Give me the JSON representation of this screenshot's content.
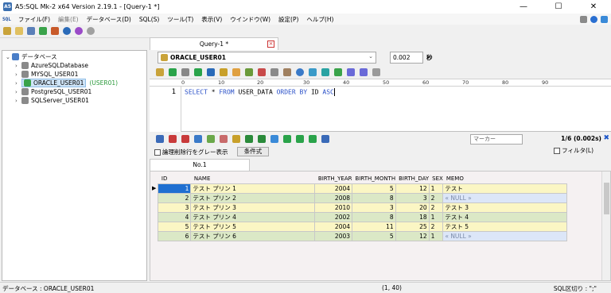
{
  "window": {
    "app_icon": "A5",
    "title": "A5:SQL Mk-2 x64 Version 2.19.1 - [Query-1 *]",
    "controls": [
      "—",
      "☐",
      "✕"
    ]
  },
  "menu": {
    "sql_tag": "SQL",
    "items": [
      "ファイル(F)",
      "編集(E)",
      "データベース(D)",
      "SQL(S)",
      "ツール(T)",
      "表示(V)",
      "ウインドウ(W)",
      "設定(P)",
      "ヘルプ(H)"
    ]
  },
  "tree": {
    "root": "データベース",
    "items": [
      {
        "label": "AzureSQLDatabase",
        "connected": ""
      },
      {
        "label": "MYSQL_USER01",
        "connected": ""
      },
      {
        "label": "ORACLE_USER01",
        "connected": "(USER01)"
      },
      {
        "label": "PostgreSQL_USER01",
        "connected": ""
      },
      {
        "label": "SQLServer_USER01",
        "connected": ""
      }
    ]
  },
  "query_tab": {
    "label": "Query-1 *"
  },
  "connection": {
    "selected": "ORACLE_USER01",
    "time": "0.002",
    "time_unit": "秒"
  },
  "ruler": {
    "marks": [
      "0",
      "10",
      "20",
      "30",
      "40",
      "50",
      "60",
      "70",
      "80",
      "90"
    ]
  },
  "editor": {
    "line_number": "1",
    "sql": {
      "k1": "SELECT",
      "sp1": " * ",
      "k2": "FROM",
      "tbl": " USER_DATA ",
      "k3": "ORDER BY",
      "col": " ID ",
      "k4": "ASC"
    }
  },
  "result": {
    "marker_placeholder": "マーカー",
    "row_count": "1/6 (0.002s)",
    "close_glyph": "✖",
    "gray_deleted_label": "論理削除行をグレー表示",
    "condition_button": "条件式",
    "filter_label": "フィルタ(L)",
    "tab_label": "No.1"
  },
  "grid": {
    "columns": [
      "ID",
      "NAME",
      "BIRTH_YEAR",
      "BIRTH_MONTH",
      "BIRTH_DAY",
      "SEX",
      "MEMO"
    ],
    "rows": [
      {
        "id": "1",
        "name": "テスト プリン 1",
        "year": "2004",
        "month": "5",
        "day": "12",
        "sex": "1",
        "memo": "テスト",
        "memo_null": false,
        "color": "yellow",
        "marker": "▶"
      },
      {
        "id": "2",
        "name": "テスト プリン 2",
        "year": "2008",
        "month": "8",
        "day": "3",
        "sex": "2",
        "memo": "« NULL »",
        "memo_null": true,
        "color": "green",
        "marker": ""
      },
      {
        "id": "3",
        "name": "テスト プリン 3",
        "year": "2010",
        "month": "3",
        "day": "20",
        "sex": "2",
        "memo": "テスト 3",
        "memo_null": false,
        "color": "yellow",
        "marker": ""
      },
      {
        "id": "4",
        "name": "テスト プリン 4",
        "year": "2002",
        "month": "8",
        "day": "18",
        "sex": "1",
        "memo": "テスト 4",
        "memo_null": false,
        "color": "green",
        "marker": ""
      },
      {
        "id": "5",
        "name": "テスト プリン 5",
        "year": "2004",
        "month": "11",
        "day": "25",
        "sex": "2",
        "memo": "テスト 5",
        "memo_null": false,
        "color": "yellow",
        "marker": ""
      },
      {
        "id": "6",
        "name": "テスト プリン 6",
        "year": "2003",
        "month": "5",
        "day": "12",
        "sex": "1",
        "memo": "« NULL »",
        "memo_null": true,
        "color": "green",
        "marker": ""
      }
    ],
    "colors": {
      "yellow": "#fbf6c4",
      "green": "#dbe8c6",
      "selected": "#1f6fd1",
      "null_bg": "#dce6f8"
    }
  },
  "status": {
    "left": "データベース : ORACLE_USER01",
    "cursor": "(1, 40)",
    "separator": "SQL区切り : \";\""
  }
}
